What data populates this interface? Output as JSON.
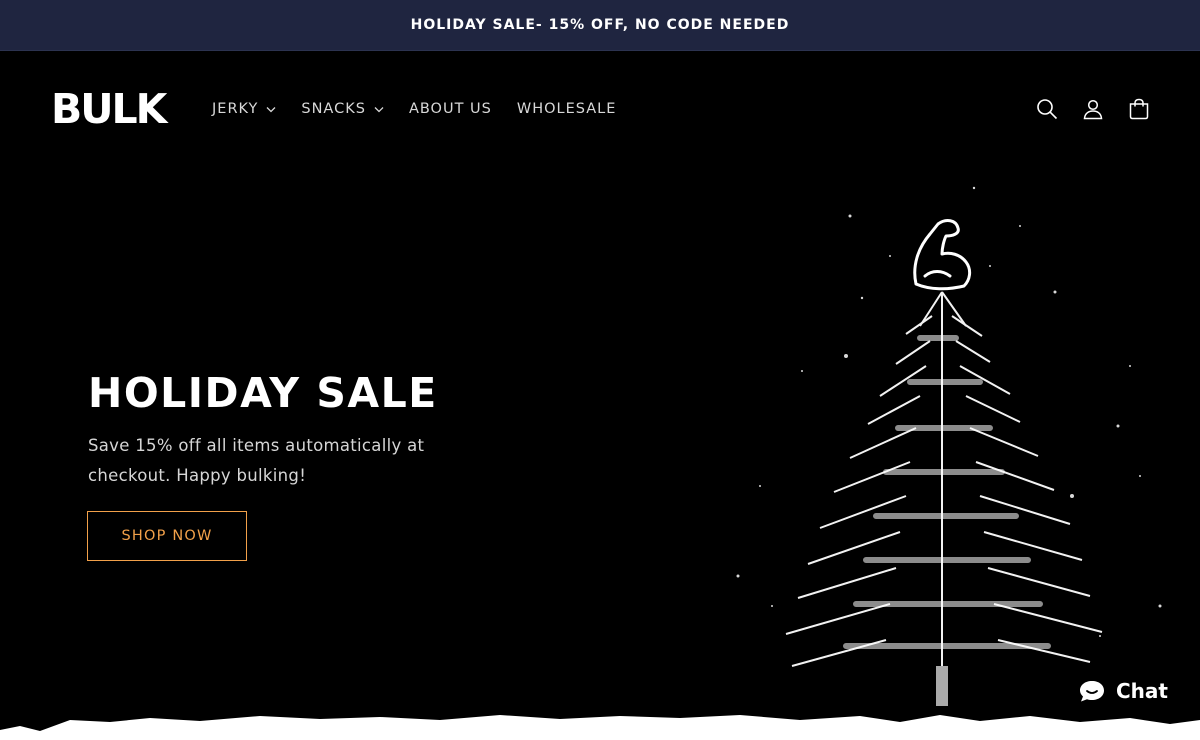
{
  "announcement": {
    "text": "HOLIDAY SALE- 15% OFF, NO CODE NEEDED"
  },
  "header": {
    "logo": "BULK",
    "nav": [
      {
        "label": "JERKY",
        "has_dropdown": true
      },
      {
        "label": "SNACKS",
        "has_dropdown": true
      },
      {
        "label": "ABOUT US",
        "has_dropdown": false
      },
      {
        "label": "WHOLESALE",
        "has_dropdown": false
      }
    ],
    "icons": [
      "search-icon",
      "account-icon",
      "cart-icon"
    ]
  },
  "hero": {
    "title": "HOLIDAY SALE",
    "subtitle": "Save 15% off all items automatically at checkout. Happy bulking!",
    "cta": "SHOP NOW"
  },
  "chat": {
    "label": "Chat",
    "icon": "chat-bubble-icon"
  },
  "colors": {
    "announcement_bg": "#1f2540",
    "page_bg": "#000000",
    "accent": "#f2a14a",
    "nav_text": "#d8d8d8"
  }
}
